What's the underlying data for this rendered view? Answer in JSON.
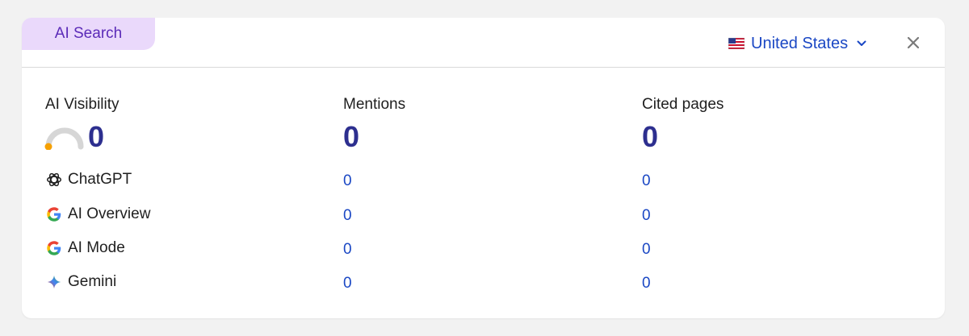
{
  "tab": {
    "label": "AI Search"
  },
  "country": {
    "label": "United States",
    "flag_icon": "us-flag-icon"
  },
  "metrics": {
    "visibility": {
      "label": "AI Visibility",
      "value": "0",
      "gauge_fraction": 0
    },
    "mentions": {
      "label": "Mentions",
      "value": "0"
    },
    "cited": {
      "label": "Cited pages",
      "value": "0"
    }
  },
  "rows": [
    {
      "name": "ChatGPT",
      "icon": "chatgpt-icon",
      "mentions": "0",
      "cited": "0"
    },
    {
      "name": "AI Overview",
      "icon": "google-icon",
      "mentions": "0",
      "cited": "0"
    },
    {
      "name": "AI Mode",
      "icon": "google-icon",
      "mentions": "0",
      "cited": "0"
    },
    {
      "name": "Gemini",
      "icon": "gemini-icon",
      "mentions": "0",
      "cited": "0"
    }
  ],
  "colors": {
    "tab_bg": "#ead9fb",
    "tab_text": "#5b2bb8",
    "link": "#1a47c4",
    "big_value": "#2d2f8f",
    "gauge_track": "#d6d6d6",
    "gauge_dot": "#f5a000"
  }
}
